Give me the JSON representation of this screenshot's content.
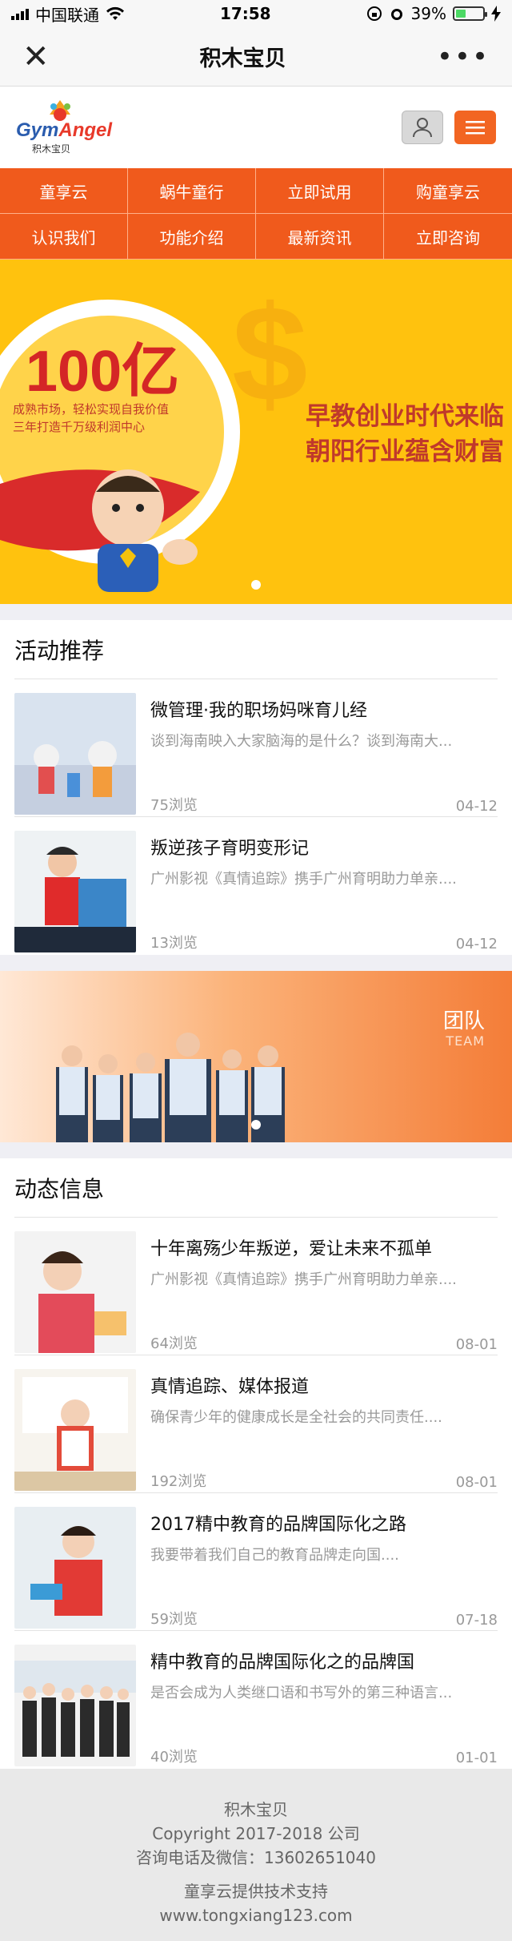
{
  "status_bar": {
    "carrier": "中国联通",
    "time": "17:58",
    "battery": "39%",
    "battery_level": 0.39
  },
  "navbar": {
    "title": "积木宝贝"
  },
  "header": {
    "logo_text_a": "Gym",
    "logo_text_b": "Angel",
    "logo_sub": "积木宝贝"
  },
  "menu": {
    "items": [
      "童享云",
      "蜗牛童行",
      "立即试用",
      "购童享云",
      "认识我们",
      "功能介绍",
      "最新资讯",
      "立即咨询"
    ]
  },
  "banner": {
    "big": "100亿",
    "small1": "成熟市场，轻松实现自我价值",
    "small2": "三年打造千万级利润中心",
    "line1": "早教创业时代来临",
    "line2": "朝阳行业蕴含财富"
  },
  "activities": {
    "title": "活动推荐",
    "items": [
      {
        "title": "微管理·我的职场妈咪育儿经",
        "desc": "谈到海南映入大家脑海的是什么？谈到海南大...",
        "views": "75浏览",
        "date": "04-12"
      },
      {
        "title": "叛逆孩子育明变形记",
        "desc": "广州影视《真情追踪》携手广州育明助力单亲....",
        "views": "13浏览",
        "date": "04-12"
      }
    ]
  },
  "team": {
    "label": "团队",
    "label_en": "TEAM"
  },
  "news": {
    "title": "动态信息",
    "items": [
      {
        "title": "十年离殇少年叛逆，爱让未来不孤单",
        "desc": "广州影视《真情追踪》携手广州育明助力单亲....",
        "views": "64浏览",
        "date": "08-01"
      },
      {
        "title": "真情追踪、媒体报道",
        "desc": "确保青少年的健康成长是全社会的共同责任....",
        "views": "192浏览",
        "date": "08-01"
      },
      {
        "title": "2017精中教育的品牌国际化之路",
        "desc": "我要带着我们自己的教育品牌走向国....",
        "views": "59浏览",
        "date": "07-18"
      },
      {
        "title": "精中教育的品牌国际化之的品牌国",
        "desc": "是否会成为人类继口语和书写外的第三种语言...",
        "views": "40浏览",
        "date": "01-01"
      }
    ]
  },
  "footer": {
    "name": "积木宝贝",
    "copyright": "Copyright 2017-2018 公司",
    "contact": "咨询电话及微信：13602651040",
    "support": "童享云提供技术支持",
    "site": "www.tongxiang123.com"
  }
}
